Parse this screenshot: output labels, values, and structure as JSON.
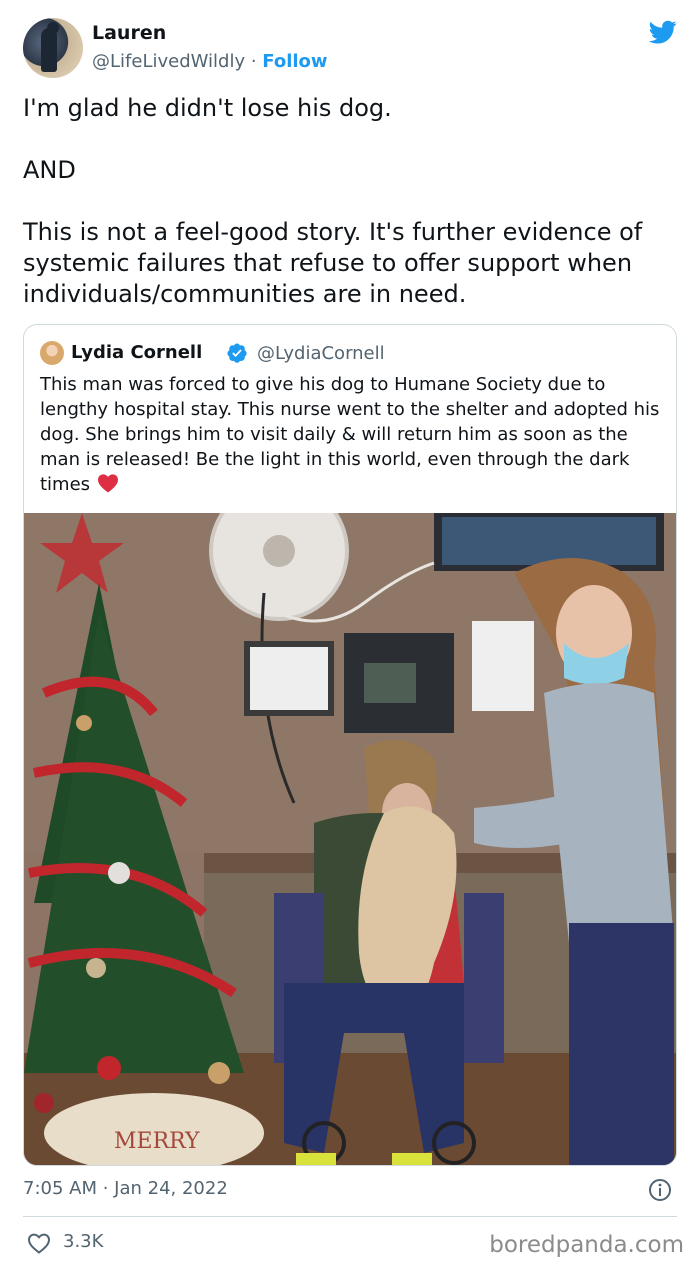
{
  "author": {
    "name": "Lauren",
    "handle": "@LifeLivedWildly",
    "separator": " · ",
    "follow_label": "Follow"
  },
  "tweet": {
    "text": "I'm glad he didn't lose his dog.\n\nAND\n\nThis is not a feel-good story. It's further evidence of systemic failures that refuse to offer support when individuals/communities are in need."
  },
  "quoted_tweet": {
    "name": "Lydia Cornell",
    "handle": "@LydiaCornell",
    "text": "This man was forced to give his dog to Humane Society due to lengthy hospital stay. This nurse went to the shelter and adopted his dog. She brings him to visit daily & will return him as soon as the man is released! Be the light in this world, even through the dark times",
    "photo_caption_text": "MERRY"
  },
  "meta": {
    "timestamp": "7:05 AM · Jan 24, 2022"
  },
  "engagement": {
    "likes": "3.3K"
  },
  "watermark": "boredpanda.com",
  "colors": {
    "twitter_blue": "#1d9bf0",
    "heart_red": "#e0245e",
    "text_primary": "#0f1419",
    "text_secondary": "#536471"
  },
  "icons": [
    "twitter-bird-icon",
    "verified-badge-icon",
    "red-heart-emoji-icon",
    "info-icon",
    "like-heart-icon"
  ]
}
